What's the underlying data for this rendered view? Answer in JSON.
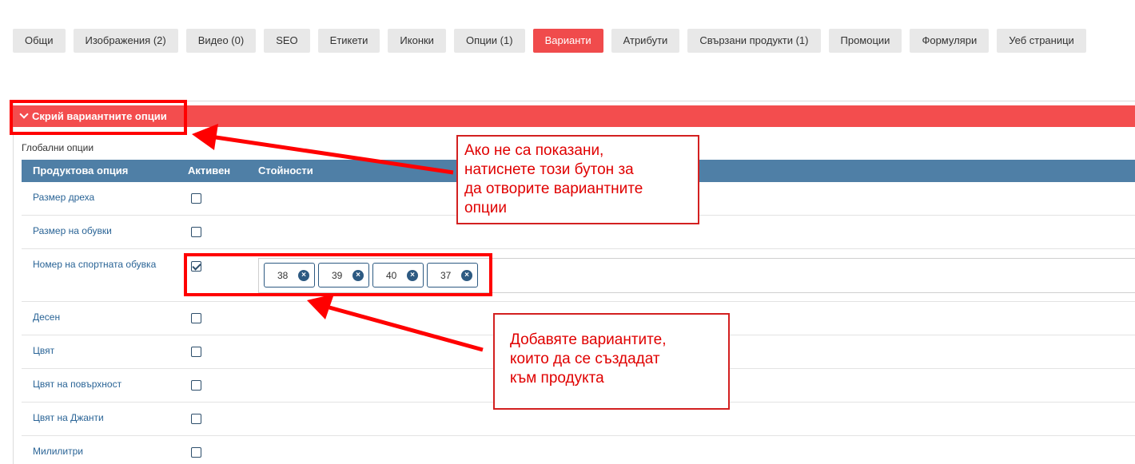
{
  "tabs": [
    {
      "label": "Общи",
      "active": false
    },
    {
      "label": "Изображения (2)",
      "active": false
    },
    {
      "label": "Видео (0)",
      "active": false
    },
    {
      "label": "SEO",
      "active": false
    },
    {
      "label": "Етикети",
      "active": false
    },
    {
      "label": "Иконки",
      "active": false
    },
    {
      "label": "Опции (1)",
      "active": false
    },
    {
      "label": "Варианти",
      "active": true
    },
    {
      "label": "Атрибути",
      "active": false
    },
    {
      "label": "Свързани продукти (1)",
      "active": false
    },
    {
      "label": "Промоции",
      "active": false
    },
    {
      "label": "Формуляри",
      "active": false
    },
    {
      "label": "Уеб страници",
      "active": false
    }
  ],
  "toggle": {
    "label": "Скрий вариантните опции"
  },
  "global_options_label": "Глобални опции",
  "table": {
    "headers": [
      "Продуктова опция",
      "Активен",
      "Стойности"
    ],
    "rows": [
      {
        "label": "Размер дреха",
        "active": false,
        "values": []
      },
      {
        "label": "Размер на обувки",
        "active": false,
        "values": []
      },
      {
        "label": "Номер на спортната обувка",
        "active": true,
        "values": [
          "38",
          "39",
          "40",
          "37"
        ]
      },
      {
        "label": "Десен",
        "active": false,
        "values": []
      },
      {
        "label": "Цвят",
        "active": false,
        "values": []
      },
      {
        "label": "Цвят на повърхност",
        "active": false,
        "values": []
      },
      {
        "label": "Цвят на Джанти",
        "active": false,
        "values": []
      },
      {
        "label": "Милилитри",
        "active": false,
        "values": []
      }
    ]
  },
  "callouts": {
    "toggle_hint": "Ако не са показани,\nнатиснете този бутон за\nда отворите вариантните\nопции",
    "values_hint": "Добавяте вариантите,\nкоито да се създадат\nкъм продукта"
  },
  "colors": {
    "accent_red": "#f34d4e",
    "header_blue": "#4f7fa6",
    "annotation_red": "#ff0000",
    "link_blue": "#2a6496"
  }
}
